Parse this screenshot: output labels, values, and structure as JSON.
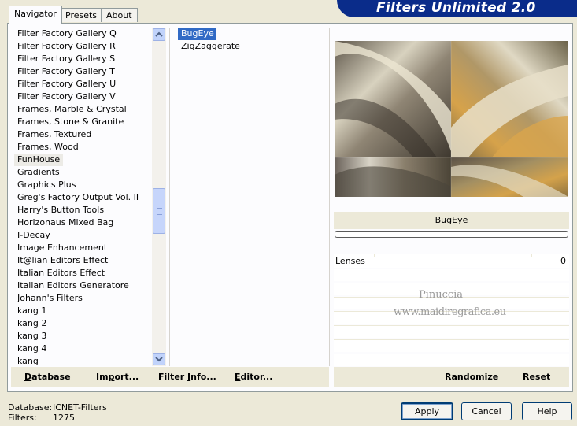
{
  "window_title": "Filters Unlimited 2.0",
  "tabs": [
    {
      "label": "Navigator",
      "active": true
    },
    {
      "label": "Presets",
      "active": false
    },
    {
      "label": "About",
      "active": false
    }
  ],
  "categories": [
    "Filter Factory Gallery Q",
    "Filter Factory Gallery R",
    "Filter Factory Gallery S",
    "Filter Factory Gallery T",
    "Filter Factory Gallery U",
    "Filter Factory Gallery V",
    "Frames, Marble & Crystal",
    "Frames, Stone & Granite",
    "Frames, Textured",
    "Frames, Wood",
    "FunHouse",
    "Gradients",
    "Graphics Plus",
    "Greg's Factory Output Vol. II",
    "Harry's Button Tools",
    "Horizonaus Mixed Bag",
    "I-Decay",
    "Image Enhancement",
    "It@lian Editors Effect",
    "Italian Editors Effect",
    "Italian Editors Generatore",
    "Johann's Filters",
    "kang 1",
    "kang 2",
    "kang 3",
    "kang 4",
    "kang"
  ],
  "selected_category": "FunHouse",
  "filters": [
    "BugEye",
    "ZigZaggerate"
  ],
  "selected_filter": "BugEye",
  "filter_name": "BugEye",
  "params": [
    {
      "label": "Lenses",
      "value": "0"
    }
  ],
  "watermark": {
    "line1": "Pinuccia",
    "line2": "www.maidiregrafica.eu"
  },
  "toolbar": {
    "database": {
      "u": "D",
      "rest": "atabase"
    },
    "import": {
      "pre": "Im",
      "u": "p",
      "rest": "ort..."
    },
    "filter_info": {
      "pre": "Filter ",
      "u": "I",
      "rest": "nfo..."
    },
    "editor": {
      "u": "E",
      "rest": "ditor..."
    },
    "randomize": "Randomize",
    "reset": "Reset"
  },
  "status": {
    "database_label": "Database:",
    "database_value": "ICNET-Filters",
    "filters_label": "Filters:",
    "filters_value": "1275"
  },
  "buttons": {
    "apply": "Apply",
    "cancel": "Cancel",
    "help": "Help"
  }
}
